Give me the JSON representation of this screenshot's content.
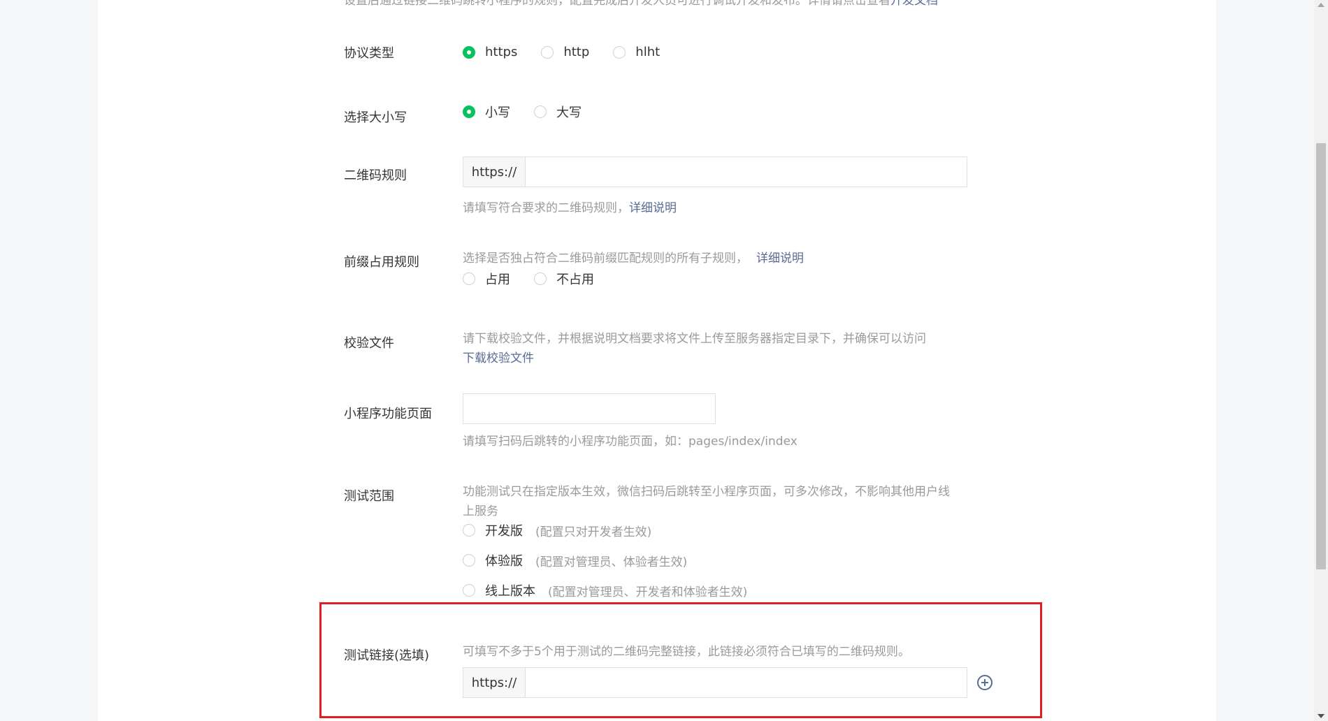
{
  "top_text": "设置后通过链接二维码跳转小程序的规则，配置完成后开发人员可进行调试开发和发布。详情请点击查看",
  "top_link": "开发文档",
  "protocol": {
    "label": "协议类型",
    "options": [
      {
        "label": "https",
        "checked": true
      },
      {
        "label": "http",
        "checked": false
      },
      {
        "label": "hlht",
        "checked": false
      }
    ]
  },
  "case": {
    "label": "选择大小写",
    "options": [
      {
        "label": "小写",
        "checked": true
      },
      {
        "label": "大写",
        "checked": false
      }
    ]
  },
  "qr_rule": {
    "label": "二维码规则",
    "prefix": "https://",
    "value": "",
    "hint": "请填写符合要求的二维码规则，",
    "hint_link": "详细说明"
  },
  "prefix_rule": {
    "label": "前缀占用规则",
    "hint": "选择是否独占符合二维码前缀匹配规则的所有子规则，",
    "hint_link": "详细说明",
    "options": [
      {
        "label": "占用",
        "checked": false
      },
      {
        "label": "不占用",
        "checked": false
      }
    ]
  },
  "verify_file": {
    "label": "校验文件",
    "hint": "请下载校验文件，并根据说明文档要求将文件上传至服务器指定目录下，并确保可以访问",
    "link": "下载校验文件"
  },
  "page_path": {
    "label": "小程序功能页面",
    "value": "",
    "hint": "请填写扫码后跳转的小程序功能页面，如：pages/index/index"
  },
  "test_scope": {
    "label": "测试范围",
    "hint_line1": "功能测试只在指定版本生效，微信扫码后跳转至小程序页面，可多次修改，不影响其他用户线",
    "hint_line2": "上服务",
    "options": [
      {
        "label": "开发版",
        "sub": "(配置只对开发者生效)",
        "checked": false
      },
      {
        "label": "体验版",
        "sub": "(配置对管理员、体验者生效)",
        "checked": false
      },
      {
        "label": "线上版本",
        "sub": "(配置对管理员、开发者和体验者生效)",
        "checked": false
      }
    ]
  },
  "test_link": {
    "label": "测试链接(选填)",
    "hint": "可填写不多于5个用于测试的二维码完整链接，此链接必须符合已填写的二维码规则。",
    "prefix": "https://",
    "value": ""
  },
  "colors": {
    "accent": "#07c160",
    "link": "#576b95",
    "highlight": "#e02020"
  }
}
